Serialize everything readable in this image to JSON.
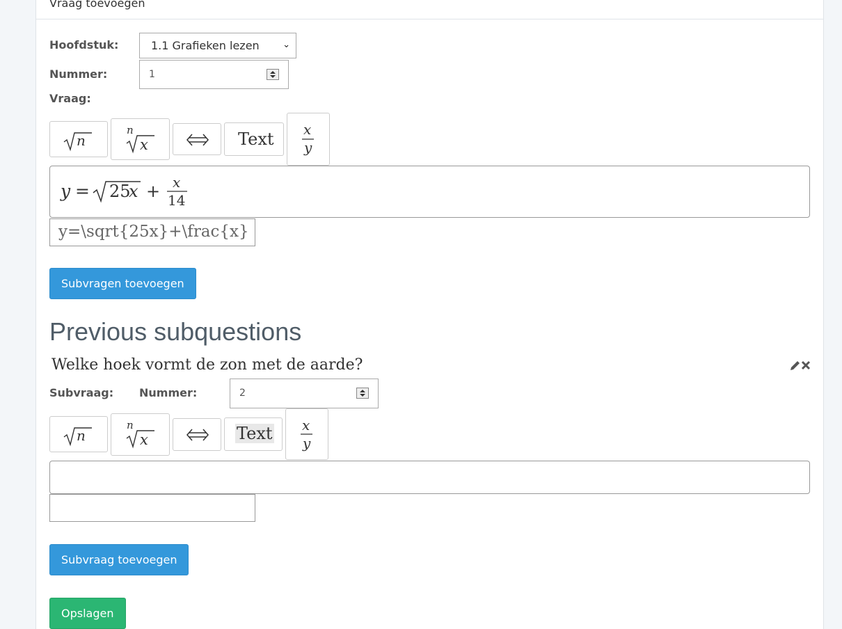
{
  "panel": {
    "title": "Vraag toevoegen"
  },
  "form": {
    "chapter_label": "Hoofdstuk:",
    "chapter_value": "1.1 Grafieken lezen",
    "number_label": "Nummer:",
    "number_value": "1",
    "question_label": "Vraag:"
  },
  "toolbar": {
    "sqrt_label": "√n",
    "nthroot_label": "n√x",
    "arrow_label": "⇔",
    "text_label": "Text",
    "frac_label": "x/y"
  },
  "question": {
    "math_rendered": "y = √25x + x/14",
    "latex": "y=\\sqrt{25x}+\\frac{x}"
  },
  "buttons": {
    "add_subquestions": "Subvragen toevoegen",
    "add_subquestion": "Subvraag toevoegen",
    "save": "Opslagen"
  },
  "previous": {
    "heading": "Previous subquestions",
    "subquestion_text": "Welke hoek vormt de zon met de aarde?",
    "subquestion_label": "Subvraag:",
    "number_label": "Nummer:",
    "number_value": "2",
    "latex": ""
  },
  "icons": {
    "edit": "pencil-icon",
    "delete": "close-icon"
  },
  "colors": {
    "primary": "#3498db",
    "success": "#2bb673"
  }
}
